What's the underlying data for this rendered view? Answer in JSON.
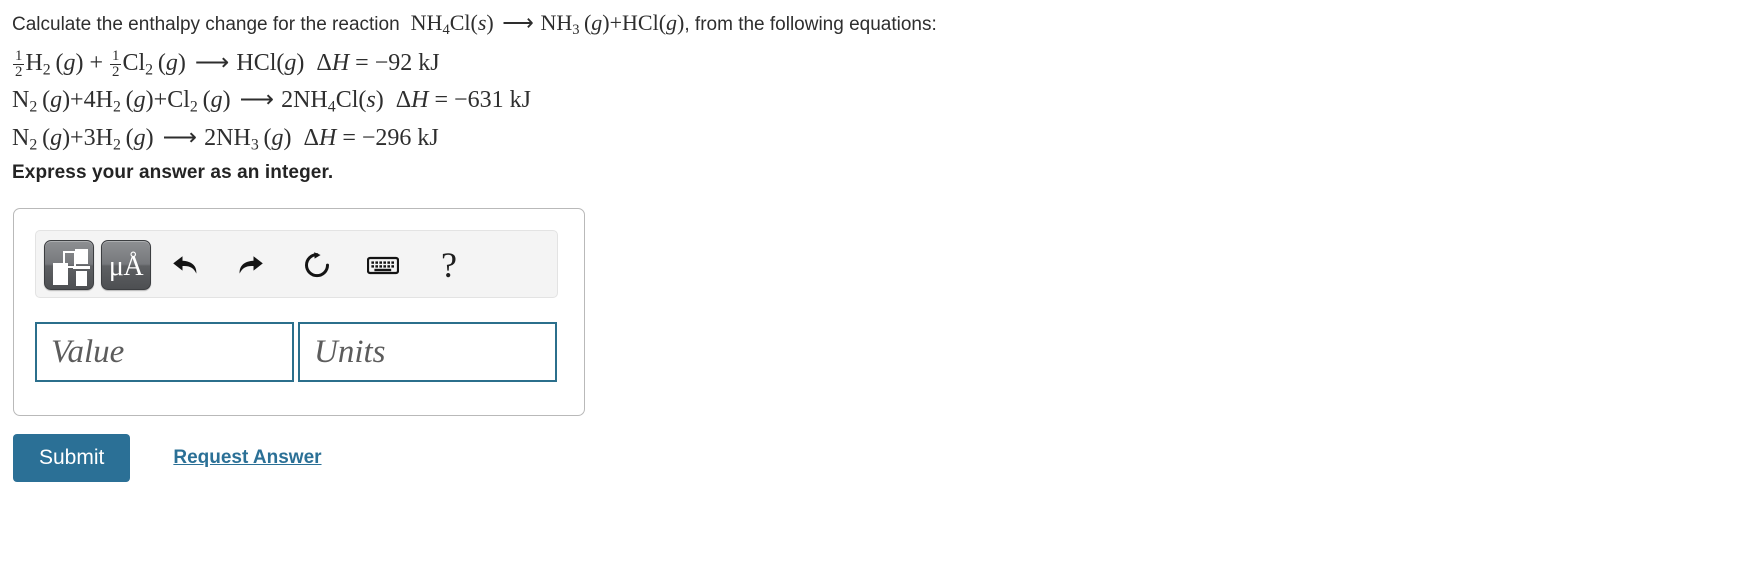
{
  "problem": {
    "intro_prefix": "Calculate the enthalpy change for the reaction",
    "intro_reaction": "NH4Cl(s) ⟶ NH3(g)+HCl(g)",
    "intro_suffix": ", from the following equations:",
    "equations": [
      {
        "id": "eq1",
        "text": "½H2(g) + ½Cl2(g) ⟶ HCl(g)",
        "delta_h_label": "ΔH",
        "delta_h_value": "−92 kJ"
      },
      {
        "id": "eq2",
        "text": "N2(g)+4H2(g)+Cl2(g) ⟶ 2NH4Cl(s)",
        "delta_h_label": "ΔH",
        "delta_h_value": "−631 kJ"
      },
      {
        "id": "eq3",
        "text": "N2(g)+3H2(g) ⟶ 2NH3(g)",
        "delta_h_label": "ΔH",
        "delta_h_value": "−296 kJ"
      }
    ]
  },
  "instruction": "Express your answer as an integer.",
  "toolbar": {
    "buttons": [
      {
        "name": "template-button",
        "label": "template-icon",
        "active": true
      },
      {
        "name": "units-button",
        "label": "μÅ",
        "active": true
      }
    ],
    "icons": [
      {
        "name": "undo-icon",
        "label": "undo"
      },
      {
        "name": "redo-icon",
        "label": "redo"
      },
      {
        "name": "reset-icon",
        "label": "reset"
      },
      {
        "name": "keyboard-icon",
        "label": "keyboard"
      },
      {
        "name": "help-icon",
        "label": "?"
      }
    ]
  },
  "answer_fields": {
    "value_placeholder": "Value",
    "value_current": "",
    "units_placeholder": "Units",
    "units_current": ""
  },
  "actions": {
    "submit_label": "Submit",
    "request_answer_label": "Request Answer"
  },
  "colors": {
    "accent": "#2b7096",
    "field_border": "#2b6f8c",
    "panel_border": "#b9b9b9",
    "toolbar_bg": "#f4f4f4",
    "text": "#2e2e2e"
  }
}
